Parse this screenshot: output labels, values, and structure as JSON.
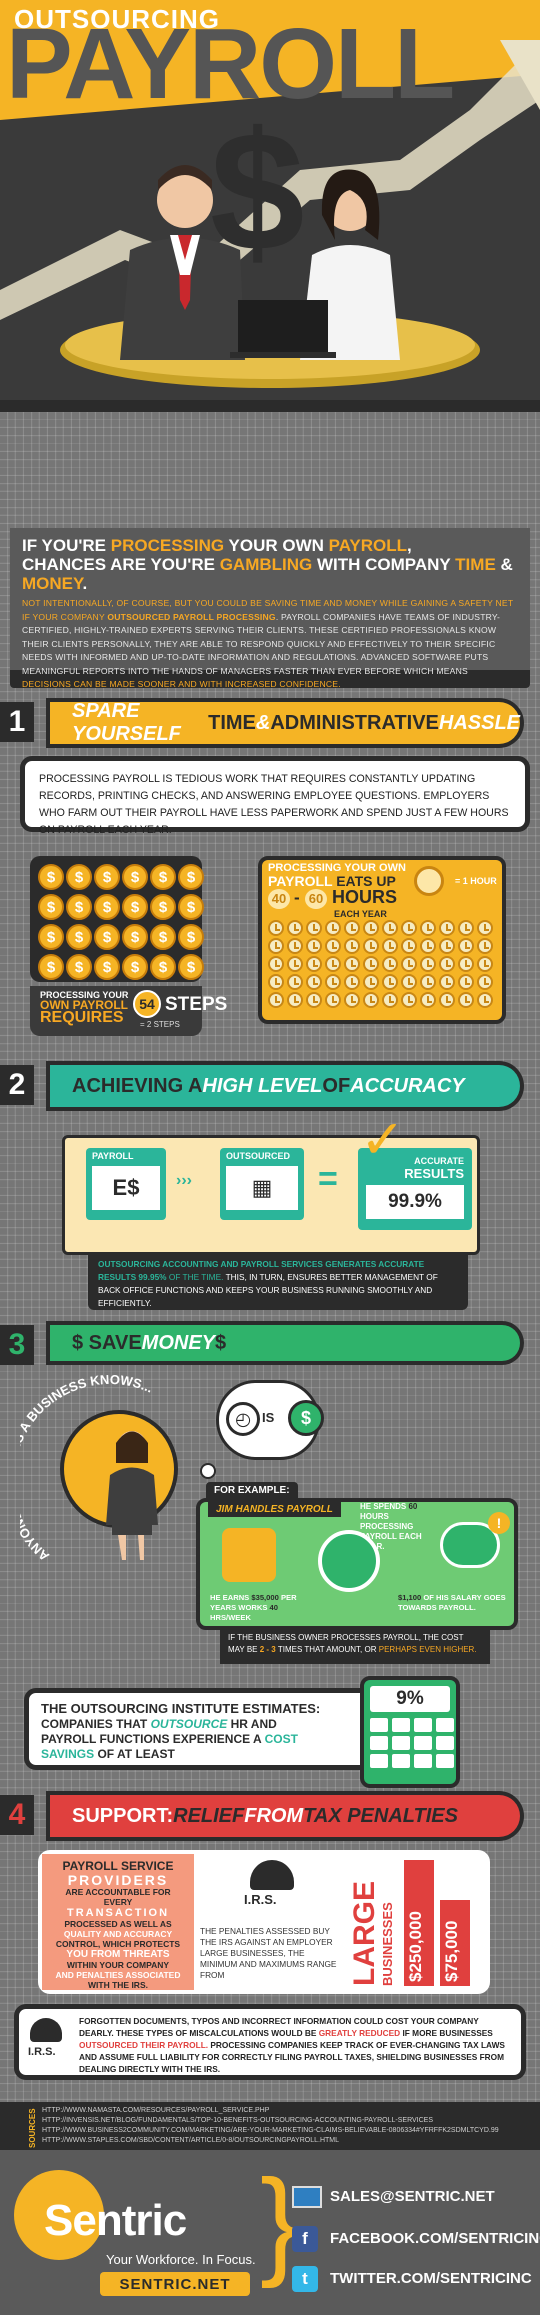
{
  "hero": {
    "title_small": "OUTSOURCING",
    "title_big": "PAYROLL"
  },
  "intro": {
    "line1": [
      "IF YOU'RE ",
      "PROCESSING",
      " YOUR OWN ",
      "PAYROLL",
      ","
    ],
    "line2": [
      "CHANCES ARE YOU'RE ",
      "GAMBLING",
      " WITH COMPANY ",
      "TIME",
      " & ",
      "MONEY",
      "."
    ],
    "p1": "NOT INTENTIONALLY, OF COURSE, BUT YOU COULD BE SAVING TIME AND MONEY WHILE GAINING A SAFETY NET IF YOUR COMPANY",
    "p1_hl": "OUTSOURCED PAYROLL PROCESSING",
    "p2": ". PAYROLL COMPANIES HAVE TEAMS OF INDUSTRY-CERTIFIED, HIGHLY-TRAINED EXPERTS SERVING THEIR CLIENTS. THESE CERTIFIED PROFESSIONALS KNOW THEIR CLIENTS PERSONALLY, THEY ARE ABLE TO RESPOND QUICKLY AND EFFECTIVELY TO THEIR SPECIFIC NEEDS WITH INFORMED AND UP-TO-DATE INFORMATION AND REGULATIONS. ADVANCED SOFTWARE PUTS MEANINGFUL REPORTS INTO THE HANDS OF MANAGERS FASTER THAN EVER BEFORE WHICH MEANS",
    "p2_hl": "DECISIONS CAN BE MADE SOONER AND WITH INCREASED CONFIDENCE."
  },
  "s1": {
    "num": "1",
    "a": "SPARE YOURSELF ",
    "b": "TIME",
    "c": " & ",
    "d": "ADMINISTRATIVE",
    "e": " HASSLE",
    "text": "PROCESSING PAYROLL IS TEDIOUS WORK THAT REQUIRES CONSTANTLY UPDATING RECORDS, PRINTING CHECKS, AND ANSWERING EMPLOYEE QUESTIONS. EMPLOYERS WHO FARM OUT THEIR PAYROLL HAVE LESS PAPERWORK AND SPEND JUST A FEW HOURS ON PAYROLL EACH YEAR.",
    "coin_glyph": "$",
    "req1": "PROCESSING YOUR",
    "req2": "OWN PAYROLL",
    "req3": "REQUIRES",
    "steps_n": "54",
    "steps": "STEPS",
    "legend_steps": "= 2 STEPS",
    "hours1": "PROCESSING YOUR OWN",
    "hours2": "PAYROLL",
    "hours3": "EATS UP",
    "h_from": "40",
    "h_sep": "-",
    "h_to": "60",
    "h_unit": "HOURS",
    "h_each": "EACH YEAR",
    "legend_hour": "= 1 HOUR"
  },
  "s2": {
    "num": "2",
    "a": "ACHIEVING A ",
    "b": "HIGH LEVEL",
    "c": " OF ",
    "d": "ACCURACY",
    "payroll": "PAYROLL",
    "outsourced": "OUTSOURCED",
    "eq": "=",
    "accurate": "ACCURATE",
    "results": "RESULTS",
    "pct": "99.9%",
    "t1": "OUTSOURCING ACCOUNTING AND PAYROLL SERVICES GENERATES ACCURATE RESULTS",
    "t2": "99.95%",
    "t3": "OF THE TIME.",
    "t4": "THIS, IN TURN, ENSURES BETTER MANAGEMENT OF BACK OFFICE FUNCTIONS AND KEEPS YOUR BUSINESS RUNNING SMOOTHLY AND EFFICIENTLY."
  },
  "s3": {
    "num": "3",
    "a": "$ SAVE ",
    "b": "MONEY",
    "c": " $",
    "arc": "ANYONE WHO RUNS A BUSINESS KNOWS...",
    "is": "IS",
    "example": "FOR EXAMPLE:",
    "jim": "JIM HANDLES PAYROLL",
    "spends1": "HE SPENDS",
    "spends2": "60",
    "spends3": "HOURS PROCESSING PAYROLL EACH YEAR.",
    "earns1": "HE EARNS",
    "earns2": "$35,000",
    "earns3": "PER YEARS WORKS",
    "earns4": "40",
    "earns5": "HRS/WEEK",
    "salary1": "$1,100",
    "salary2": "OF HIS SALARY GOES TOWARDS PAYROLL.",
    "cost1": "IF THE BUSINESS OWNER PROCESSES PAYROLL, THE COST MAY BE",
    "cost2": "2 - 3",
    "cost3": "TIMES THAT AMOUNT, OR",
    "cost4": "PERHAPS EVEN HIGHER."
  },
  "oi": {
    "l1": "THE OUTSOURCING INSTITUTE ESTIMATES:",
    "l2a": "COMPANIES THAT ",
    "l2b": "OUTSOURCE",
    "l2c": " HR AND",
    "l3": "PAYROLL FUNCTIONS EXPERIENCE A ",
    "l3b": "COST",
    "l4a": "SAVINGS",
    "l4b": " OF AT LEAST",
    "pct": "9%"
  },
  "s4": {
    "num": "4",
    "a": "SUPPORT: ",
    "b": "RELIEF",
    "c": " FROM ",
    "d": "TAX PENALTIES",
    "p1": "PAYROLL SERVICE",
    "p2": "PROVIDERS",
    "p3": "ARE ACCOUNTABLE FOR EVERY",
    "p4": "TRANSACTION",
    "p5": "PROCESSED AS WELL AS",
    "p6": "QUALITY AND ACCURACY",
    "p7": "CONTROL, WHICH PROTECTS",
    "p8": "YOU FROM THREATS",
    "p9": "WITHIN YOUR COMPANY",
    "p10": "AND PENALTIES ASSOCIATED",
    "p11": "WITH THE IRS.",
    "irs": "I.R.S.",
    "pen": "THE PENALTIES ASSESSED BUY THE IRS AGAINST AN EMPLOYER LARGE BUSINESSES, THE MINIMUM AND MAXIMUMS RANGE FROM",
    "large": "LARGE",
    "bus": "BUSINESSES",
    "v1": "$250,000",
    "v2": "$75,000",
    "f1": "FORGOTTEN DOCUMENTS, TYPOS AND INCORRECT INFORMATION COULD COST YOUR COMPANY DEARLY. THESE TYPES OF MISCALCULATIONS WOULD BE",
    "f2": "GREATLY REDUCED",
    "f3": "IF MORE BUSINESSES",
    "f4": "OUTSOURCED THEIR PAYROLL.",
    "f5": "PROCESSING COMPANIES KEEP TRACK OF EVER-CHANGING TAX LAWS AND ASSUME FULL LIABILITY FOR CORRECTLY FILING PAYROLL TAXES, SHIELDING BUSINESSES FROM DEALING DIRECTLY WITH THE IRS."
  },
  "sources": {
    "label": "SOURCES",
    "items": [
      "HTTP://WWW.NAMASTA.COM/RESOURCES/PAYROLL_SERVICE.PHP",
      "HTTP://INVENSIS.NET/BLOG/FUNDAMENTALS/TOP-10-BENEFITS-OUTSOURCING-ACCOUNTING-PAYROLL-SERVICES",
      "HTTP://WWW.BUSINESS2COMMUNITY.COM/MARKETING/ARE-YOUR-MARKETING-CLAIMS-BELIEVABLE-0806334#YFRFFK2SDMLTCYD.99",
      "HTTP://WWW.STAPLES.COM/SBD/CONTENT/ARTICLE/0-8/OUTSOURCINGPAYROLL.HTML"
    ]
  },
  "footer": {
    "brand": "Sentric",
    "tag": "Your Workforce. In Focus.",
    "site": "SENTRIC.NET",
    "email": "SALES@SENTRIC.NET",
    "fb": "FACEBOOK.COM/SENTRICINC",
    "tw": "TWITTER.COM/SENTRICINC",
    "fb_glyph": "f",
    "tw_glyph": "t"
  },
  "colors": {
    "orange": "#f7a823",
    "teal": "#2bb59a",
    "red": "#e0403e",
    "green": "#2fb36b",
    "dark": "#2b2b2b"
  }
}
